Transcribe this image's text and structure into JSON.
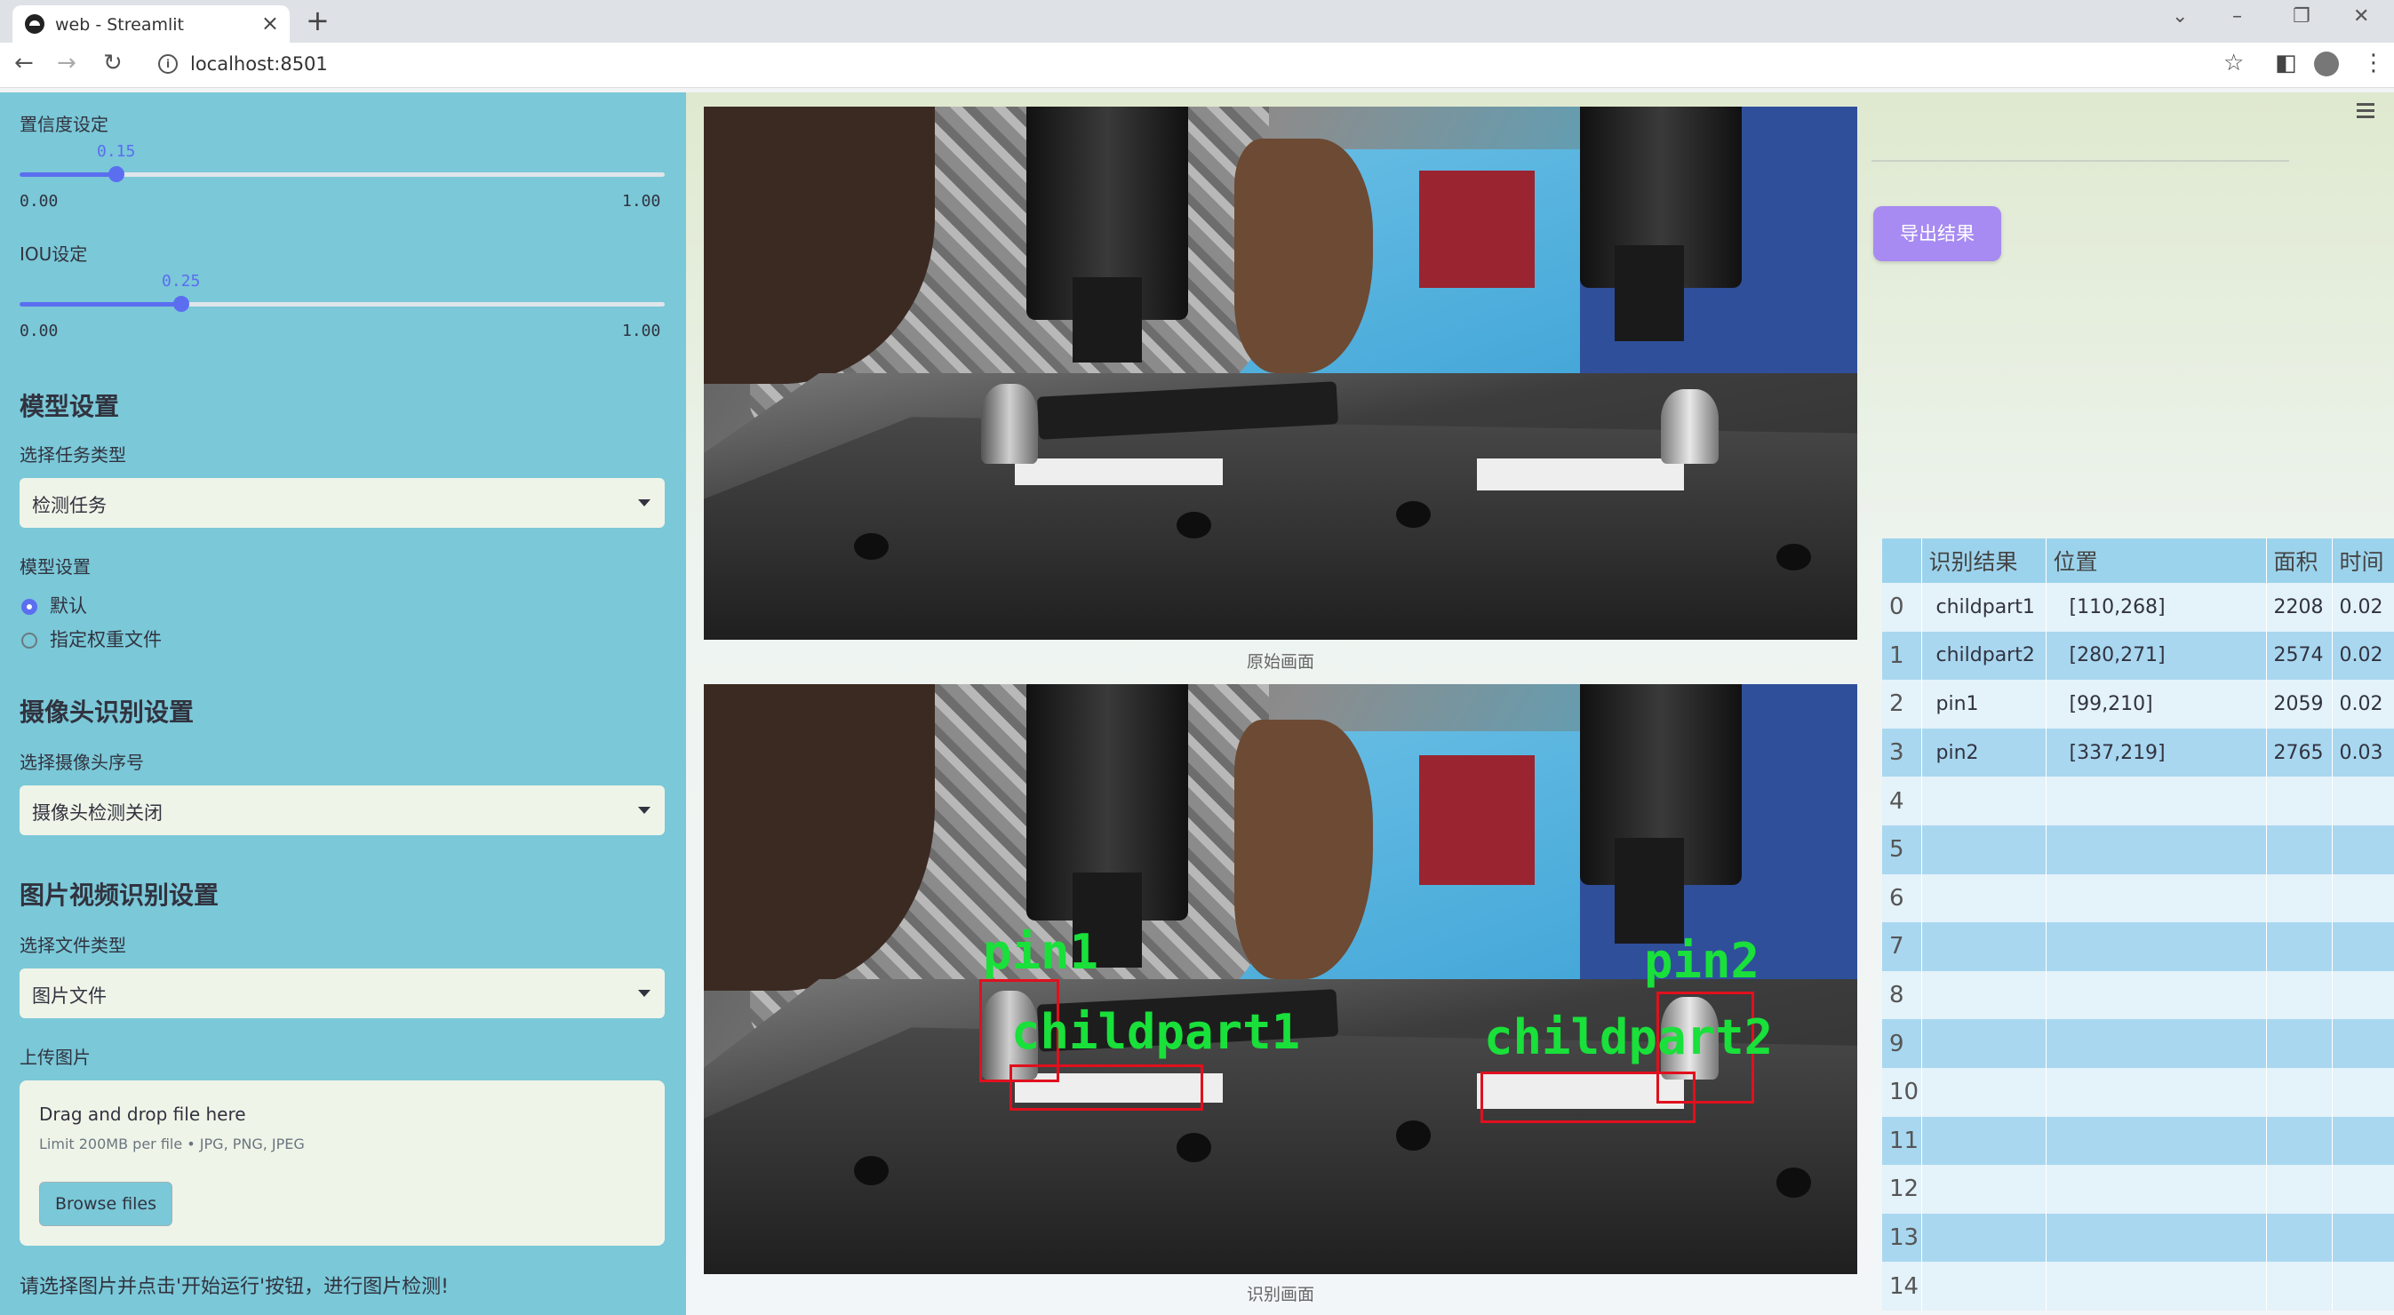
{
  "browser": {
    "tab_title": "web - Streamlit",
    "url": "localhost:8501"
  },
  "sidebar": {
    "conf_label": "置信度设定",
    "conf_value": 0.15,
    "conf_value_text": "0.15",
    "conf_min": "0.00",
    "conf_max": "1.00",
    "iou_label": "IOU设定",
    "iou_value": 0.25,
    "iou_value_text": "0.25",
    "iou_min": "0.00",
    "iou_max": "1.00",
    "model_header": "模型设置",
    "task_type_label": "选择任务类型",
    "task_type_value": "检测任务",
    "model_setting_label": "模型设置",
    "radio_default": "默认",
    "radio_custom": "指定权重文件",
    "camera_header": "摄像头识别设置",
    "camera_select_label": "选择摄像头序号",
    "camera_select_value": "摄像头检测关闭",
    "media_header": "图片视频识别设置",
    "file_type_label": "选择文件类型",
    "file_type_value": "图片文件",
    "upload_label": "上传图片",
    "upload_title": "Drag and drop file here",
    "upload_limit": "Limit 200MB per file • JPG, PNG, JPEG",
    "browse_label": "Browse files",
    "note": "请选择图片并点击'开始运行'按钮，进行图片检测!"
  },
  "main": {
    "caption_original": "原始画面",
    "caption_result": "识别画面",
    "export_label": "导出结果",
    "detections": [
      {
        "label": "pin1"
      },
      {
        "label": "childpart1"
      },
      {
        "label": "pin2"
      },
      {
        "label": "childpart2"
      }
    ]
  },
  "table": {
    "columns": [
      "",
      "识别结果",
      "位置",
      "面积",
      "时间"
    ],
    "rows": [
      {
        "idx": "0",
        "name": "childpart1",
        "pos": "[110,268]",
        "area": "2208",
        "time": "0.02"
      },
      {
        "idx": "1",
        "name": "childpart2",
        "pos": "[280,271]",
        "area": "2574",
        "time": "0.02"
      },
      {
        "idx": "2",
        "name": "pin1",
        "pos": "[99,210]",
        "area": "2059",
        "time": "0.02"
      },
      {
        "idx": "3",
        "name": "pin2",
        "pos": "[337,219]",
        "area": "2765",
        "time": "0.03"
      },
      {
        "idx": "4",
        "name": "",
        "pos": "",
        "area": "",
        "time": ""
      },
      {
        "idx": "5",
        "name": "",
        "pos": "",
        "area": "",
        "time": ""
      },
      {
        "idx": "6",
        "name": "",
        "pos": "",
        "area": "",
        "time": ""
      },
      {
        "idx": "7",
        "name": "",
        "pos": "",
        "area": "",
        "time": ""
      },
      {
        "idx": "8",
        "name": "",
        "pos": "",
        "area": "",
        "time": ""
      },
      {
        "idx": "9",
        "name": "",
        "pos": "",
        "area": "",
        "time": ""
      },
      {
        "idx": "10",
        "name": "",
        "pos": "",
        "area": "",
        "time": ""
      },
      {
        "idx": "11",
        "name": "",
        "pos": "",
        "area": "",
        "time": ""
      },
      {
        "idx": "12",
        "name": "",
        "pos": "",
        "area": "",
        "time": ""
      },
      {
        "idx": "13",
        "name": "",
        "pos": "",
        "area": "",
        "time": ""
      },
      {
        "idx": "14",
        "name": "",
        "pos": "",
        "area": "",
        "time": ""
      }
    ]
  },
  "colors": {
    "sidebar_bg": "#7ac8d8",
    "accent": "#5b6ef0",
    "export_button": "#a78bf2",
    "box": "#e0101e",
    "box_label": "#19e03a"
  },
  "icons": [
    "back-icon",
    "forward-icon",
    "reload-icon",
    "info-icon",
    "star-icon",
    "sidepanel-icon",
    "profile-icon",
    "more-icon",
    "hamburger-menu-icon",
    "caret-down-icon"
  ]
}
